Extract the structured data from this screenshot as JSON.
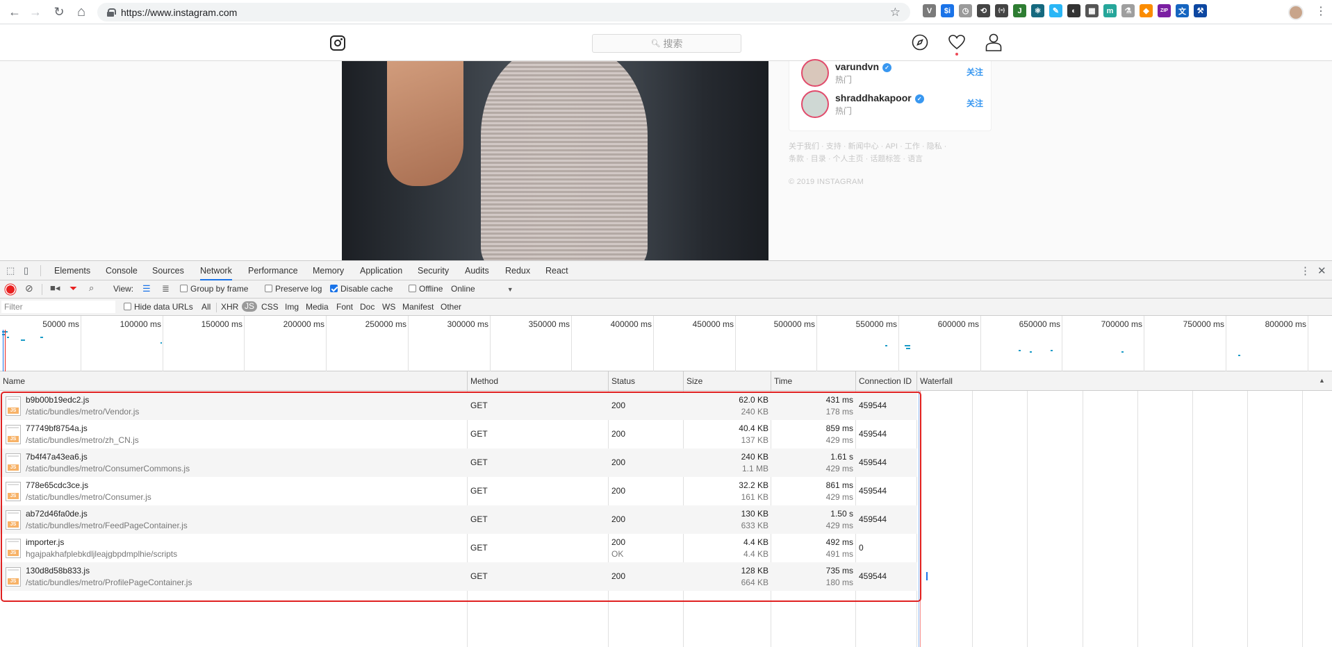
{
  "browser": {
    "url": "https://www.instagram.com",
    "nav": {
      "back": "←",
      "forward": "→",
      "reload": "↻",
      "home": "⌂"
    },
    "extensions": [
      {
        "icon": "vue-icon",
        "glyph": "V",
        "color": "#7a7a7a"
      },
      {
        "icon": "dollar-icon",
        "glyph": "$i",
        "color": "#1a73e8"
      },
      {
        "icon": "clock-icon",
        "glyph": "◷",
        "color": "#9a9a9a"
      },
      {
        "icon": "sync-icon",
        "glyph": "⟲",
        "color": "#444444"
      },
      {
        "icon": "bracket-icon",
        "glyph": "{≡}",
        "color": "#444444"
      },
      {
        "icon": "j-icon",
        "glyph": "J",
        "color": "#2e7d32"
      },
      {
        "icon": "react-icon",
        "glyph": "⚛",
        "color": "#15697f"
      },
      {
        "icon": "feather-icon",
        "glyph": "✎",
        "color": "#29b6f6"
      },
      {
        "icon": "dark-icon",
        "glyph": "◐",
        "color": "#333333"
      },
      {
        "icon": "calendar-icon",
        "glyph": "▦",
        "color": "#555555"
      },
      {
        "icon": "m-icon",
        "glyph": "m",
        "color": "#26a69a"
      },
      {
        "icon": "flask-icon",
        "glyph": "⚗",
        "color": "#9e9e9e"
      },
      {
        "icon": "fox-icon",
        "glyph": "◆",
        "color": "#fb8c00"
      },
      {
        "icon": "zip-icon",
        "glyph": "ZIP",
        "color": "#7b1fa2"
      },
      {
        "icon": "translate-icon",
        "glyph": "文",
        "color": "#1565c0"
      },
      {
        "icon": "tool-icon",
        "glyph": "⚒",
        "color": "#0d47a1"
      }
    ]
  },
  "instagram": {
    "search_placeholder": "搜索",
    "suggestions": [
      {
        "name": "varundvn",
        "subtitle": "热门",
        "action": "关注"
      },
      {
        "name": "shraddhakapoor",
        "subtitle": "热门",
        "action": "关注"
      }
    ],
    "footer_links_1": "关于我们 · 支持 · 新闻中心 · API · 工作 · 隐私 ·",
    "footer_links_2": "条款 · 目录 · 个人主页 · 话题标签 · 语言",
    "copyright": "© 2019 INSTAGRAM"
  },
  "devtools": {
    "tabs": [
      "Elements",
      "Console",
      "Sources",
      "Network",
      "Performance",
      "Memory",
      "Application",
      "Security",
      "Audits",
      "Redux",
      "React"
    ],
    "active_tab": "Network",
    "toolbar": {
      "view_label": "View:",
      "group_by_frame": "Group by frame",
      "preserve_log": "Preserve log",
      "disable_cache": "Disable cache",
      "offline": "Offline",
      "throttle": "Online"
    },
    "filter": {
      "placeholder": "Filter",
      "hide_data_urls": "Hide data URLs",
      "types": [
        "All",
        "XHR",
        "JS",
        "CSS",
        "Img",
        "Media",
        "Font",
        "Doc",
        "WS",
        "Manifest",
        "Other"
      ],
      "selected_type": "JS"
    },
    "overview_ticks": [
      "50000 ms",
      "100000 ms",
      "150000 ms",
      "200000 ms",
      "250000 ms",
      "300000 ms",
      "350000 ms",
      "400000 ms",
      "450000 ms",
      "500000 ms",
      "550000 ms",
      "600000 ms",
      "650000 ms",
      "700000 ms",
      "750000 ms",
      "800000 ms"
    ],
    "columns": [
      "Name",
      "Method",
      "Status",
      "Size",
      "Time",
      "Connection ID",
      "Waterfall"
    ],
    "sort_indicator": "▲",
    "requests": [
      {
        "name": "b9b00b19edc2.js",
        "path": "/static/bundles/metro/Vendor.js",
        "method": "GET",
        "status": "200",
        "status_text": "",
        "size": "62.0 KB",
        "content": "240 KB",
        "time": "431 ms",
        "latency": "178 ms",
        "conn": "459544"
      },
      {
        "name": "77749bf8754a.js",
        "path": "/static/bundles/metro/zh_CN.js",
        "method": "GET",
        "status": "200",
        "status_text": "",
        "size": "40.4 KB",
        "content": "137 KB",
        "time": "859 ms",
        "latency": "429 ms",
        "conn": "459544"
      },
      {
        "name": "7b4f47a43ea6.js",
        "path": "/static/bundles/metro/ConsumerCommons.js",
        "method": "GET",
        "status": "200",
        "status_text": "",
        "size": "240 KB",
        "content": "1.1 MB",
        "time": "1.61 s",
        "latency": "429 ms",
        "conn": "459544"
      },
      {
        "name": "778e65cdc3ce.js",
        "path": "/static/bundles/metro/Consumer.js",
        "method": "GET",
        "status": "200",
        "status_text": "",
        "size": "32.2 KB",
        "content": "161 KB",
        "time": "861 ms",
        "latency": "429 ms",
        "conn": "459544"
      },
      {
        "name": "ab72d46fa0de.js",
        "path": "/static/bundles/metro/FeedPageContainer.js",
        "method": "GET",
        "status": "200",
        "status_text": "",
        "size": "130 KB",
        "content": "633 KB",
        "time": "1.50 s",
        "latency": "429 ms",
        "conn": "459544"
      },
      {
        "name": "importer.js",
        "path": "hgajpakhafplebkdljleajgbpdmplhie/scripts",
        "method": "GET",
        "status": "200",
        "status_text": "OK",
        "size": "4.4 KB",
        "content": "4.4 KB",
        "time": "492 ms",
        "latency": "491 ms",
        "conn": "0"
      },
      {
        "name": "130d8d58b833.js",
        "path": "/static/bundles/metro/ProfilePageContainer.js",
        "method": "GET",
        "status": "200",
        "status_text": "",
        "size": "128 KB",
        "content": "664 KB",
        "time": "735 ms",
        "latency": "180 ms",
        "conn": "459544"
      }
    ],
    "file_badge": "JS"
  }
}
